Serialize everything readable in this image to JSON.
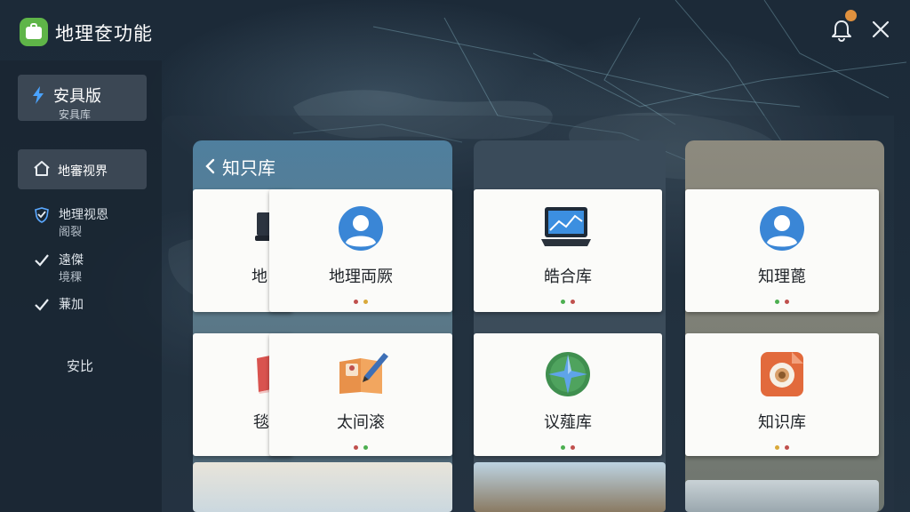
{
  "app": {
    "title": "地理奁功能",
    "logo_icon": "briefcase-icon"
  },
  "topbar": {
    "bell_icon": "bell-icon",
    "close_icon": "close-icon"
  },
  "sidebar": {
    "edition": {
      "title": "安具版",
      "subtitle": "安具库"
    },
    "active_item": {
      "label": "地審视界",
      "icon": "home-icon"
    },
    "items": [
      {
        "line1": "地理视恩",
        "line2": "阁裂",
        "icon": "shield-check-icon"
      },
      {
        "line1": "遠傑",
        "line2": "境稞",
        "icon": "check-icon"
      },
      {
        "line1": "蒹加",
        "line2": "",
        "icon": "check-icon"
      }
    ],
    "footer": "安比"
  },
  "main": {
    "back_label": "知只库",
    "cards": [
      {
        "title": "地",
        "dots": []
      },
      {
        "title": "地理両厥",
        "icon": "user-avatar-icon",
        "dots": [
          "#c0504d",
          "#d9a93a"
        ]
      },
      {
        "title": "皓合库",
        "icon": "laptop-chart-icon",
        "dots": [
          "#4caf50",
          "#c0504d"
        ]
      },
      {
        "title": "知理蓖",
        "icon": "user-avatar-icon",
        "dots": [
          "#4caf50",
          "#c0504d"
        ]
      },
      {
        "title": "毯",
        "icon": "book-icon",
        "dots": []
      },
      {
        "title": "太间滚",
        "icon": "book-pencil-icon",
        "dots": [
          "#c0504d",
          "#4caf50"
        ]
      },
      {
        "title": "议薤库",
        "icon": "compass-star-icon",
        "dots": [
          "#4caf50",
          "#c0504d"
        ]
      },
      {
        "title": "知识库",
        "icon": "camera-lens-icon",
        "dots": [
          "#d9a93a",
          "#c0504d"
        ]
      }
    ]
  }
}
